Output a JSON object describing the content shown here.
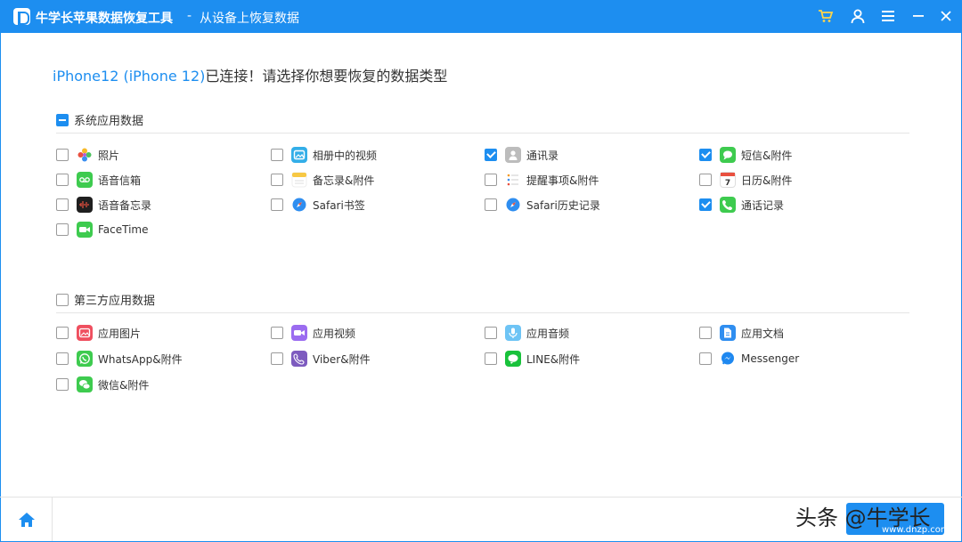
{
  "window": {
    "title": "牛学长苹果数据恢复工具",
    "separator": "-",
    "subtitle": "从设备上恢复数据"
  },
  "headline": {
    "device": "iPhone12 (iPhone 12)",
    "text": "已连接！请选择你想要恢复的数据类型"
  },
  "system_section": {
    "label": "系统应用数据",
    "state": "partial",
    "items": [
      {
        "label": "照片",
        "checked": false,
        "icon": "photos-icon"
      },
      {
        "label": "相册中的视频",
        "checked": false,
        "icon": "album-video-icon"
      },
      {
        "label": "通讯录",
        "checked": true,
        "icon": "contacts-icon"
      },
      {
        "label": "短信&附件",
        "checked": true,
        "icon": "messages-icon"
      },
      {
        "label": "语音信箱",
        "checked": false,
        "icon": "voicemail-icon"
      },
      {
        "label": "备忘录&附件",
        "checked": false,
        "icon": "notes-icon"
      },
      {
        "label": "提醒事项&附件",
        "checked": false,
        "icon": "reminders-icon"
      },
      {
        "label": "日历&附件",
        "checked": false,
        "icon": "calendar-icon"
      },
      {
        "label": "语音备忘录",
        "checked": false,
        "icon": "voice-memos-icon"
      },
      {
        "label": "Safari书签",
        "checked": false,
        "icon": "safari-icon"
      },
      {
        "label": "Safari历史记录",
        "checked": false,
        "icon": "safari-icon"
      },
      {
        "label": "通话记录",
        "checked": true,
        "icon": "phone-icon"
      },
      {
        "label": "FaceTime",
        "checked": false,
        "icon": "facetime-icon"
      }
    ]
  },
  "third_party_section": {
    "label": "第三方应用数据",
    "state": "unchecked",
    "items": [
      {
        "label": "应用图片",
        "checked": false,
        "icon": "app-photo-icon"
      },
      {
        "label": "应用视频",
        "checked": false,
        "icon": "app-video-icon"
      },
      {
        "label": "应用音频",
        "checked": false,
        "icon": "app-audio-icon"
      },
      {
        "label": "应用文档",
        "checked": false,
        "icon": "app-document-icon"
      },
      {
        "label": "WhatsApp&附件",
        "checked": false,
        "icon": "whatsapp-icon"
      },
      {
        "label": "Viber&附件",
        "checked": false,
        "icon": "viber-icon"
      },
      {
        "label": "LINE&附件",
        "checked": false,
        "icon": "line-icon"
      },
      {
        "label": "Messenger",
        "checked": false,
        "icon": "messenger-icon"
      },
      {
        "label": "微信&附件",
        "checked": false,
        "icon": "wechat-icon"
      }
    ]
  },
  "watermark": {
    "text": "头条 @牛学长",
    "small": "www.dnzp.com"
  },
  "colors": {
    "accent": "#1d8ef0"
  }
}
